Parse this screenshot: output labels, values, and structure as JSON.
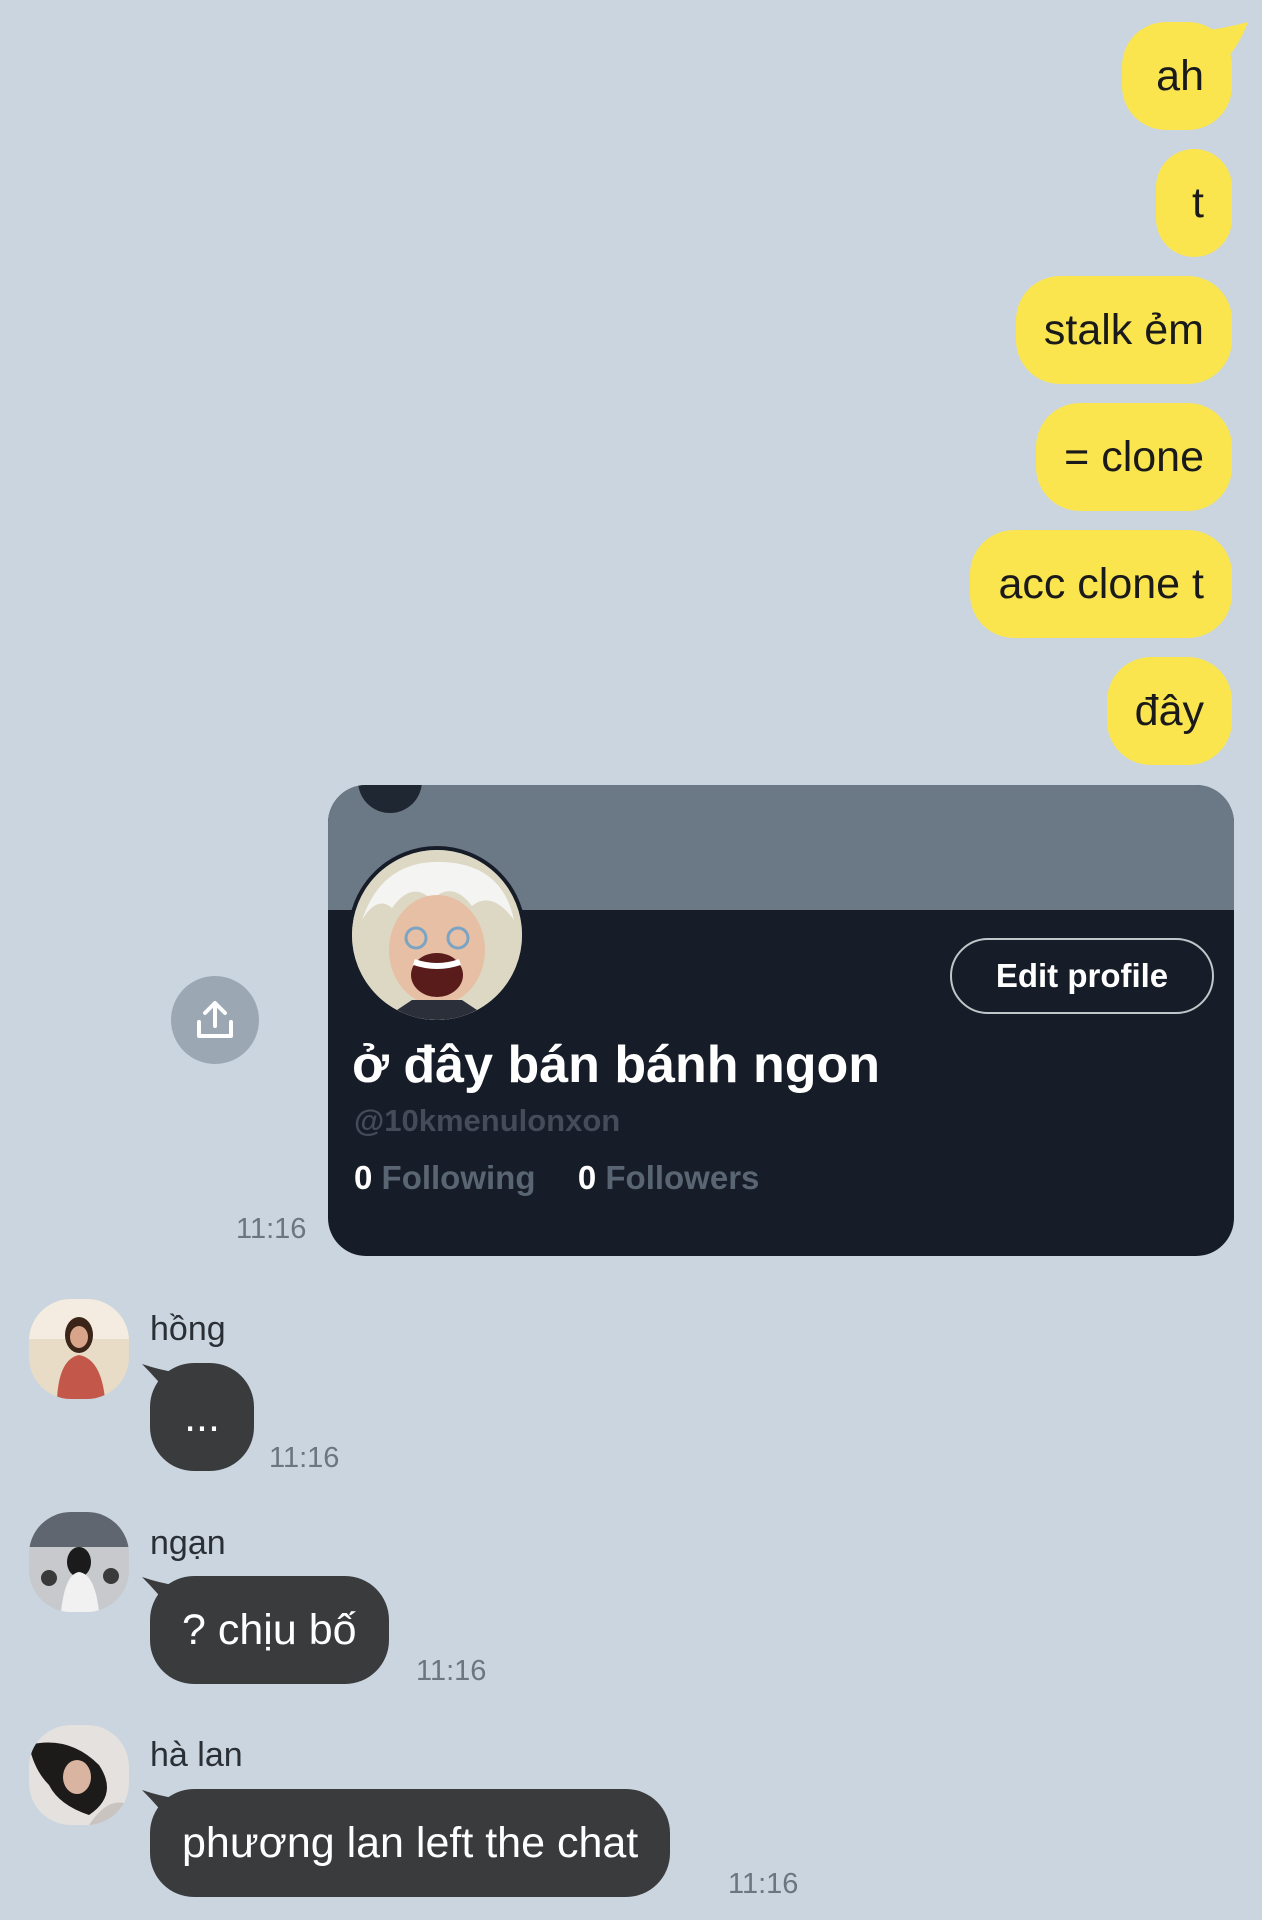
{
  "outgoing": [
    "ah",
    "t",
    "stalk ẻm",
    "= clone",
    "acc clone t",
    "đây"
  ],
  "shared_card": {
    "edit_button": "Edit profile",
    "name": "ở đây bán bánh ngon",
    "handle": "@10kmenulonxon",
    "following_count": "0",
    "following_label": "Following",
    "followers_count": "0",
    "followers_label": "Followers",
    "time": "11:16"
  },
  "incoming": [
    {
      "sender": "hồng",
      "text": "...",
      "time": "11:16"
    },
    {
      "sender": "ngạn",
      "text": "? chịu bố",
      "time": "11:16"
    },
    {
      "sender": "hà lan",
      "text": "phương lan left the chat",
      "time": "11:16"
    }
  ],
  "colors": {
    "background": "#cad5df",
    "outgoing_bubble": "#fae54f",
    "incoming_bubble": "#3a3b3d"
  }
}
